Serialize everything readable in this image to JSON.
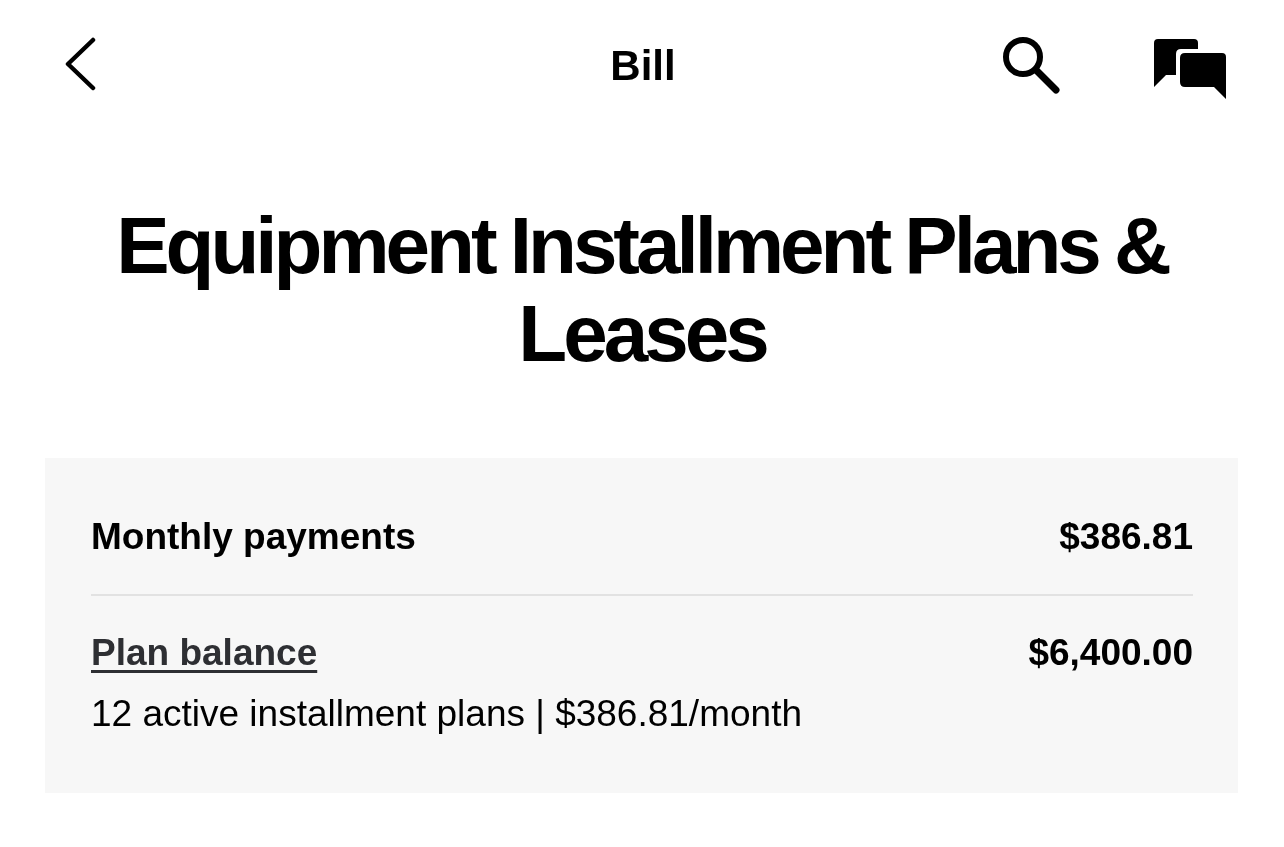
{
  "header": {
    "title": "Bill"
  },
  "heading": "Equipment Installment Plans & Leases",
  "summary": {
    "rows": [
      {
        "kind": "total",
        "label": "Monthly payments",
        "amount": "$386.81"
      },
      {
        "kind": "link",
        "label": "Plan balance",
        "amount": "$6,400.00",
        "detail": "12 active installment plans | $386.81/month"
      }
    ]
  }
}
